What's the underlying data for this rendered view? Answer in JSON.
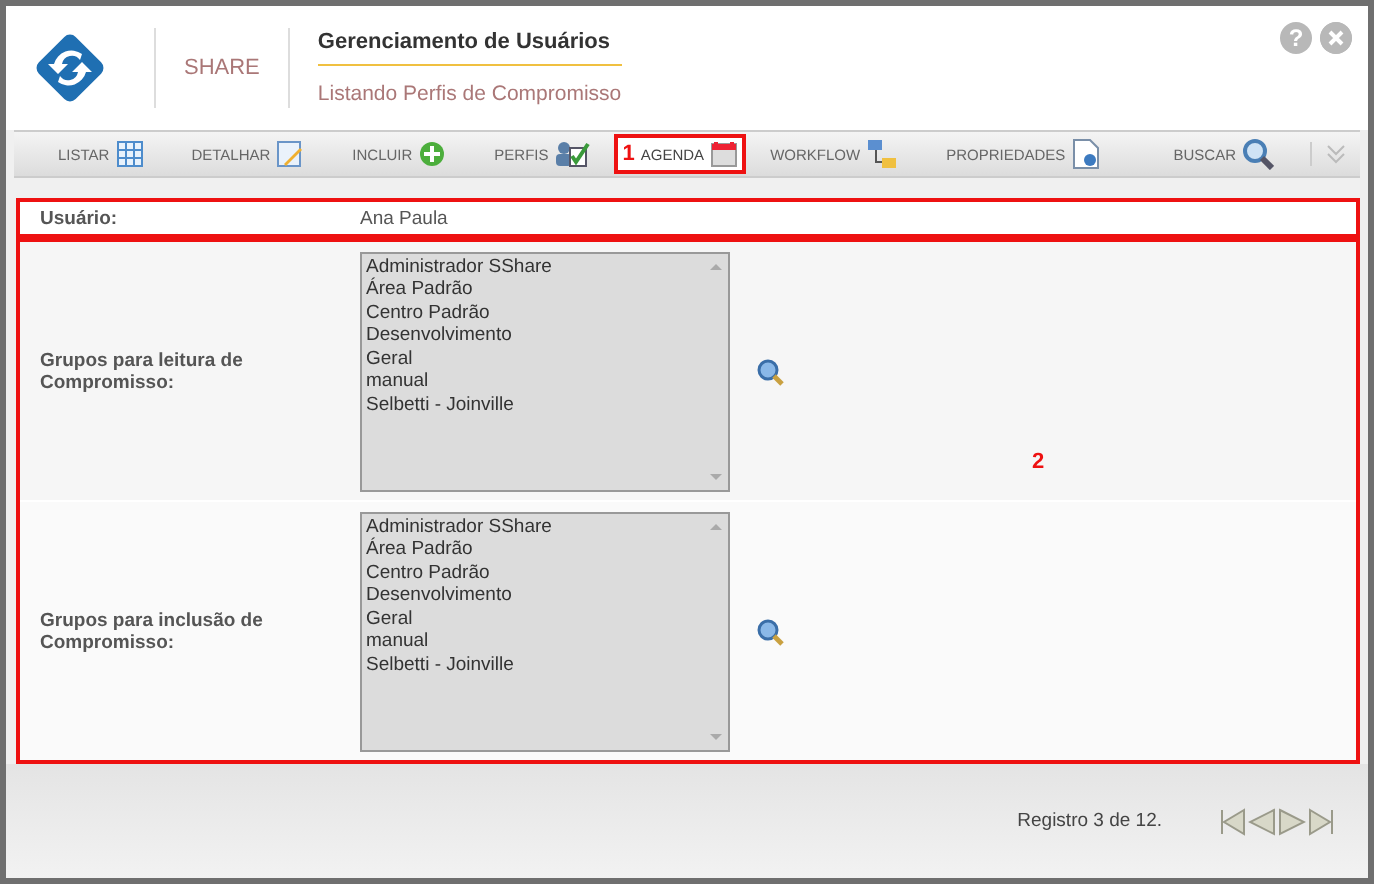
{
  "header": {
    "brand": "SHARE",
    "title": "Gerenciamento de Usuários",
    "subtitle": "Listando Perfis de Compromisso"
  },
  "help": "?",
  "tabs": [
    {
      "label": "LISTAR",
      "kind": "table",
      "selected": false
    },
    {
      "label": "DETALHAR",
      "kind": "edit",
      "selected": false
    },
    {
      "label": "INCLUIR",
      "kind": "plus",
      "selected": false
    },
    {
      "label": "PERFIS",
      "kind": "users",
      "selected": false
    },
    {
      "label": "AGENDA",
      "kind": "calendar",
      "selected": true,
      "callout": "1"
    },
    {
      "label": "WORKFLOW",
      "kind": "flow",
      "selected": false
    },
    {
      "label": "PROPRIEDADES",
      "kind": "doc",
      "selected": false
    }
  ],
  "search": {
    "label": "BUSCAR"
  },
  "form": {
    "callout": "2",
    "user_label": "Usuário:",
    "user_value": "Ana Paula",
    "groups": [
      {
        "label": "Grupos para leitura de Compromisso:",
        "items": [
          "Administrador SShare",
          "Área Padrão",
          "Centro Padrão",
          "Desenvolvimento",
          "Geral",
          "manual",
          "Selbetti - Joinville"
        ]
      },
      {
        "label": "Grupos para inclusão de Compromisso:",
        "items": [
          "Administrador SShare",
          "Área Padrão",
          "Centro Padrão",
          "Desenvolvimento",
          "Geral",
          "manual",
          "Selbetti - Joinville"
        ]
      }
    ]
  },
  "footer": {
    "record": "Registro 3 de 12."
  }
}
